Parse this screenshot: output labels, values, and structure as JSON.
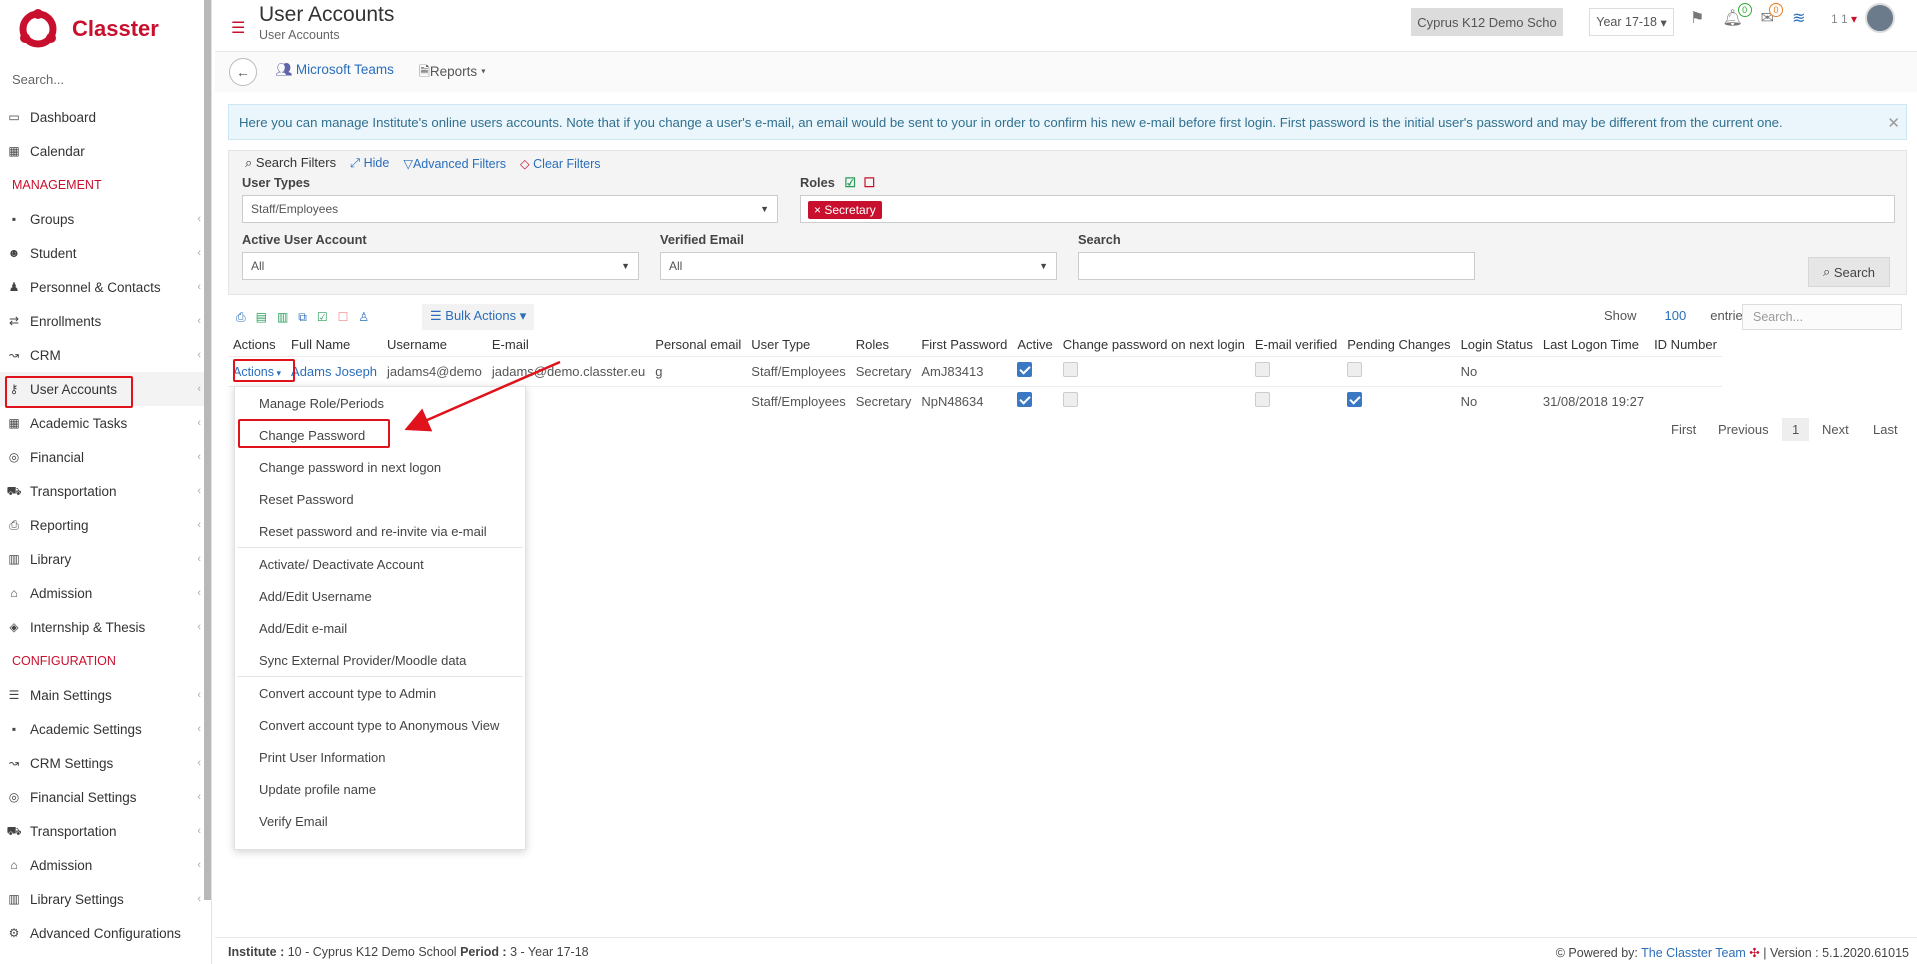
{
  "brand": {
    "name": "Classter"
  },
  "sidebar": {
    "search_placeholder": "Search...",
    "items": [
      {
        "label": "Dashboard",
        "icon": "monitor-icon"
      },
      {
        "label": "Calendar",
        "icon": "calendar-icon"
      },
      {
        "section": "MANAGEMENT"
      },
      {
        "label": "Groups",
        "icon": "groups-icon"
      },
      {
        "label": "Student",
        "icon": "student-icon"
      },
      {
        "label": "Personnel & Contacts",
        "icon": "personnel-icon"
      },
      {
        "label": "Enrollments",
        "icon": "enrollments-icon"
      },
      {
        "label": "CRM",
        "icon": "crm-icon"
      },
      {
        "label": "User Accounts",
        "icon": "key-icon"
      },
      {
        "label": "Academic Tasks",
        "icon": "grid-icon"
      },
      {
        "label": "Financial",
        "icon": "coins-icon"
      },
      {
        "label": "Transportation",
        "icon": "bus-icon"
      },
      {
        "label": "Reporting",
        "icon": "printer-icon"
      },
      {
        "label": "Library",
        "icon": "books-icon"
      },
      {
        "label": "Admission",
        "icon": "institution-icon"
      },
      {
        "label": "Internship & Thesis",
        "icon": "cube-icon"
      },
      {
        "section": "CONFIGURATION"
      },
      {
        "label": "Main Settings",
        "icon": "sliders-icon"
      },
      {
        "label": "Academic Settings",
        "icon": "groups-icon"
      },
      {
        "label": "CRM Settings",
        "icon": "crm-icon"
      },
      {
        "label": "Financial Settings",
        "icon": "coins-icon"
      },
      {
        "label": "Transportation",
        "icon": "bus-icon"
      },
      {
        "label": "Admission",
        "icon": "institution-icon"
      },
      {
        "label": "Library Settings",
        "icon": "books-icon"
      },
      {
        "label": "Advanced Configurations",
        "icon": "gears-icon"
      }
    ]
  },
  "header": {
    "title": "User Accounts",
    "subtitle": "User Accounts",
    "school": "Cyprus K12 Demo Scho",
    "year": "Year 17-18",
    "notif_count": "0",
    "mail_count": "0",
    "user": "1 1"
  },
  "subbar": {
    "teams": "Microsoft Teams",
    "reports": "Reports"
  },
  "info": "Here you can manage Institute's online users accounts. Note that if you change a user's e-mail, an email would be sent to your in order to confirm his new e-mail before first login. First password is the initial user's password and may be different from the current one.",
  "filters": {
    "search_filters": "Search Filters",
    "hide": "Hide",
    "advanced": "Advanced Filters",
    "clear": "Clear Filters",
    "user_types_label": "User Types",
    "user_types_value": "Staff/Employees",
    "roles_label": "Roles",
    "roles_tag": "Secretary",
    "active_label": "Active User Account",
    "active_value": "All",
    "verified_label": "Verified Email",
    "verified_value": "All",
    "search_label": "Search",
    "search_button": "Search"
  },
  "toolbar": {
    "bulk": "Bulk Actions",
    "show": "Show",
    "entries_count": "100",
    "entries": "entries",
    "search_placeholder": "Search..."
  },
  "table": {
    "headers": [
      "Actions",
      "Full Name",
      "Username",
      "E-mail",
      "Personal email",
      "User Type",
      "Roles",
      "First Password",
      "Active",
      "Change password on next login",
      "E-mail verified",
      "Pending Changes",
      "Login Status",
      "Last Logon Time",
      "ID Number"
    ],
    "rows": [
      {
        "action": "Actions",
        "name": "Adams Joseph",
        "username": "jadams4@demo",
        "email": "jadams@demo.classter.eu",
        "personal": "g",
        "type": "Staff/Employees",
        "roles": "Secretary",
        "pw": "AmJ83413",
        "active": true,
        "chg": false,
        "verified": false,
        "pending": false,
        "status": "No",
        "last": "",
        "id": ""
      },
      {
        "action": "",
        "name": "",
        "username": "",
        "email": "",
        "personal": "",
        "type": "Staff/Employees",
        "roles": "Secretary",
        "pw": "NpN48634",
        "active": true,
        "chg": false,
        "verified": false,
        "pending": true,
        "status": "No",
        "last": "31/08/2018 19:27",
        "id": ""
      }
    ]
  },
  "pagination": {
    "first": "First",
    "previous": "Previous",
    "page": "1",
    "next": "Next",
    "last": "Last"
  },
  "menu": {
    "groups": [
      [
        "Manage Role/Periods",
        "Change Password",
        "Change password in next logon",
        "Reset Password",
        "Reset password and re-invite via e-mail"
      ],
      [
        "Activate/ Deactivate Account",
        "Add/Edit Username",
        "Add/Edit e-mail",
        "Sync External Provider/Moodle data"
      ],
      [
        "Convert account type to Admin",
        "Convert account type to Anonymous View",
        "Print User Information",
        "Update profile name",
        "Verify Email"
      ]
    ]
  },
  "footer": {
    "institute_label": "Institute :",
    "institute": "10 - Cyprus K12 Demo School",
    "period_label": "Period :",
    "period": "3 - Year 17-18",
    "powered": "Powered by:",
    "team": "The Classter Team",
    "version": "| Version : 5.1.2020.61015"
  }
}
